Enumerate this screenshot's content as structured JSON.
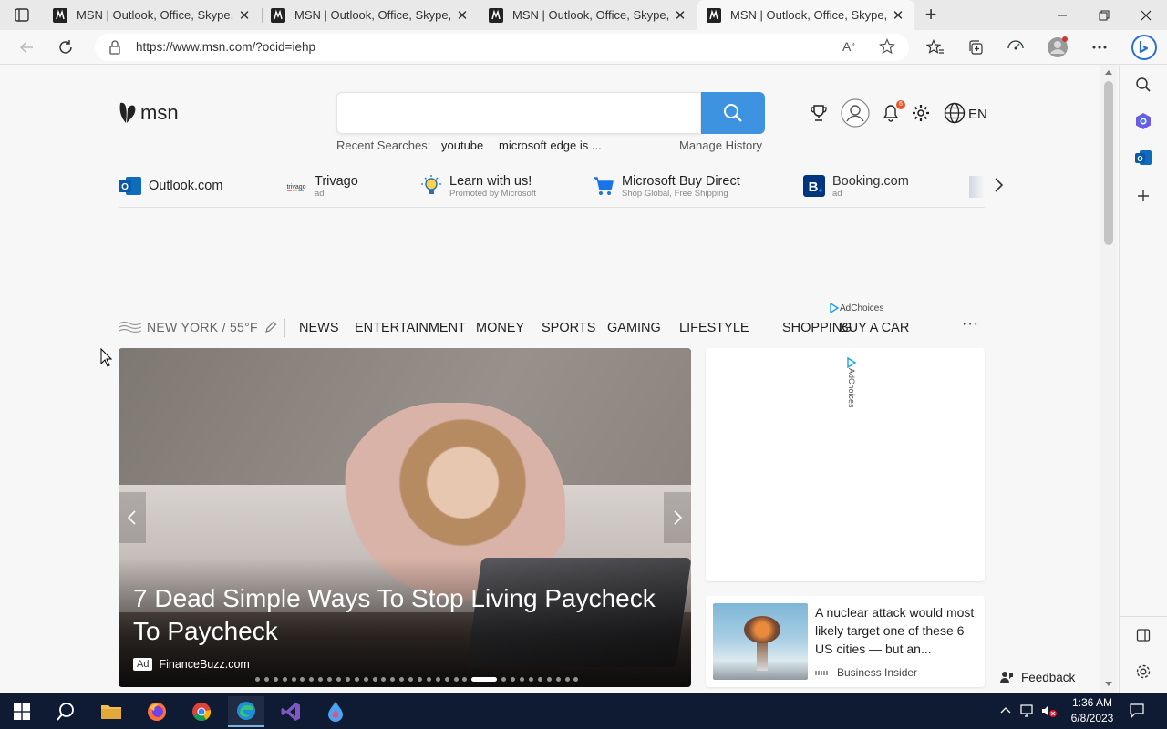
{
  "browser": {
    "tabs": [
      {
        "title": "MSN | Outlook, Office, Skype, Bing",
        "active": false
      },
      {
        "title": "MSN | Outlook, Office, Skype, Bing",
        "active": false
      },
      {
        "title": "MSN | Outlook, Office, Skype, Bing",
        "active": false
      },
      {
        "title": "MSN | Outlook, Office, Skype, Bing",
        "active": true
      }
    ],
    "url": "https://www.msn.com/?ocid=iehp"
  },
  "header": {
    "logo_text": "msn",
    "recent_label": "Recent Searches:",
    "recent_items": [
      "youtube",
      "microsoft edge is ..."
    ],
    "manage_history": "Manage History",
    "notification_count": "6",
    "language": "EN"
  },
  "quick_links": [
    {
      "name": "Outlook.com",
      "sub": "",
      "icon": "outlook-icon"
    },
    {
      "name": "Trivago",
      "sub": "ad",
      "icon": "trivago-icon"
    },
    {
      "name": "Learn with us!",
      "sub": "Promoted by Microsoft",
      "icon": "lightbulb-icon"
    },
    {
      "name": "Microsoft Buy Direct",
      "sub": "Shop Global, Free Shipping",
      "icon": "cart-icon"
    },
    {
      "name": "Booking.com",
      "sub": "ad",
      "icon": "booking-icon"
    }
  ],
  "nav": {
    "ad_choices": "AdChoices",
    "weather": "NEW YORK / 55°F",
    "items": [
      "NEWS",
      "ENTERTAINMENT",
      "MONEY",
      "SPORTS",
      "GAMING",
      "LIFESTYLE",
      "SHOPPING",
      "BUY A CAR"
    ],
    "more": "···"
  },
  "hero": {
    "headline": "7 Dead Simple Ways To Stop Living Paycheck To Paycheck",
    "ad_label": "Ad",
    "source": "FinanceBuzz.com",
    "slide_count": 34,
    "active_slide": 24
  },
  "side_ad": {
    "ad_choices": "AdChoices"
  },
  "news": {
    "title": "A nuclear attack would most likely target one of these 6 US cities — but an...",
    "source": "Business Insider"
  },
  "feedback": "Feedback",
  "taskbar": {
    "time": "1:36 AM",
    "date": "6/8/2023"
  },
  "colors": {
    "search_button": "#3e93e0",
    "taskbar": "#0f1a33",
    "notification_badge": "#e8562a"
  }
}
